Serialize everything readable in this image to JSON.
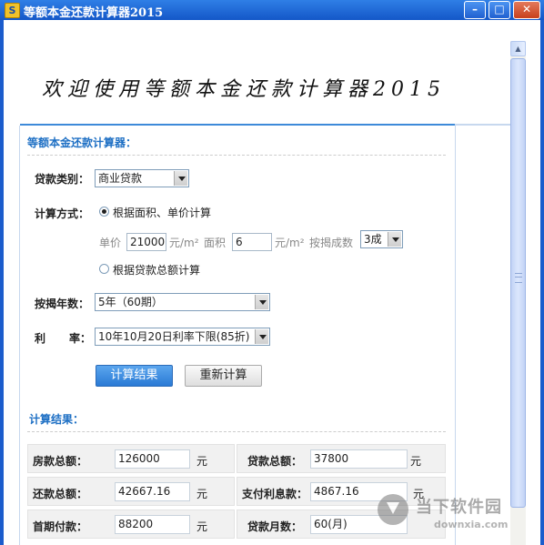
{
  "window": {
    "title": "等额本金还款计算器2015",
    "icon_letter": "S",
    "buttons": {
      "minimize": "–",
      "maximize": "□",
      "close": "✕"
    }
  },
  "banner": {
    "text": "欢迎使用等额本金还款计算器2015"
  },
  "form": {
    "section_title": "等额本金还款计算器：",
    "loan_type": {
      "label": "贷款类别：",
      "selected": "商业贷款"
    },
    "calc_method": {
      "label": "计算方式：",
      "option1": "根据面积、单价计算",
      "option1_selected": true,
      "unit_price_label": "单价",
      "unit_price_value": "21000",
      "unit_price_unit": "元/m²",
      "area_label": "面积",
      "area_value": "6",
      "area_unit": "元/m²",
      "mortgage_ratio_label": "按揭成数",
      "mortgage_ratio_selected": "3成",
      "option2": "根据贷款总额计算",
      "option2_selected": false
    },
    "years": {
      "label": "按揭年数：",
      "selected": "5年（60期）"
    },
    "rate": {
      "label_left": "利",
      "label_right": "率：",
      "selected": "10年10月20日利率下限(85折)"
    },
    "calc_button": "计算结果",
    "reset_button": "重新计算"
  },
  "results": {
    "section_title": "计算结果：",
    "rows": [
      [
        {
          "label": "房款总额：",
          "value": "126000",
          "unit": "元"
        },
        {
          "label": "贷款总额：",
          "value": "37800",
          "unit": "元"
        }
      ],
      [
        {
          "label": "还款总额：",
          "value": "42667.16",
          "unit": "元"
        },
        {
          "label": "支付利息款：",
          "value": "4867.16",
          "unit": "元"
        }
      ],
      [
        {
          "label": "首期付款：",
          "value": "88200",
          "unit": "元"
        },
        {
          "label": "贷款月数：",
          "value": "60(月)",
          "unit": ""
        }
      ]
    ]
  },
  "watermark": {
    "name": "当下软件园",
    "url": "downxia.com"
  }
}
